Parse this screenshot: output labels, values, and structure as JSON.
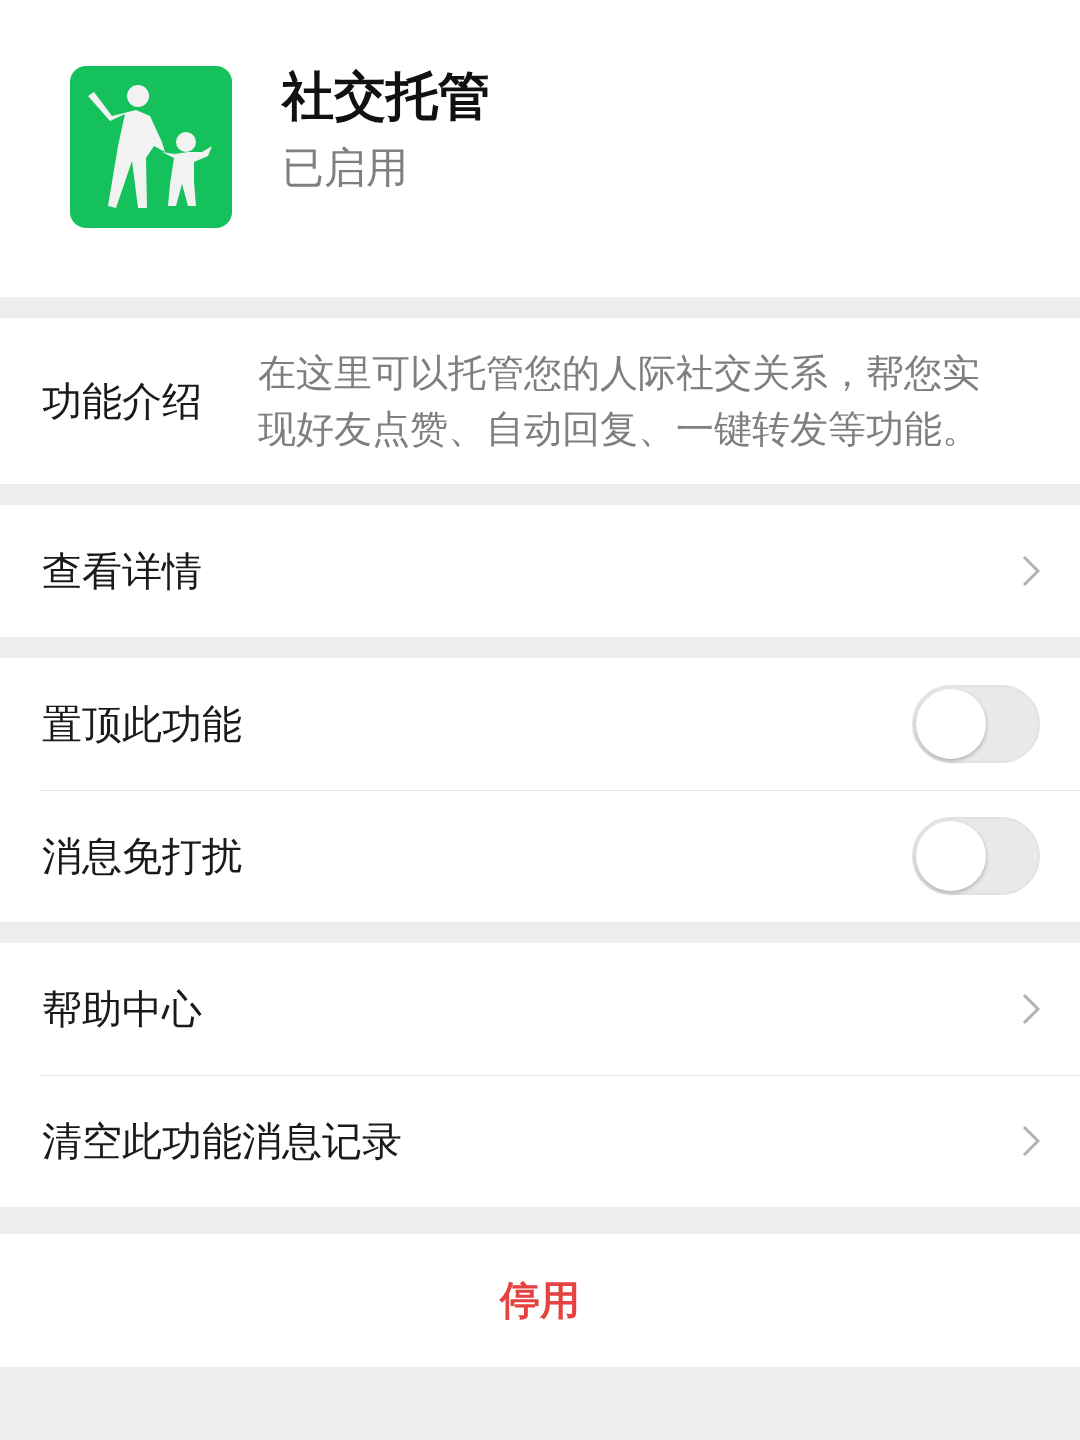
{
  "app": {
    "name": "社交托管",
    "status": "已启用"
  },
  "intro": {
    "label": "功能介绍",
    "text": "在这里可以托管您的人际社交关系，帮您实现好友点赞、自动回复、一键转发等功能。"
  },
  "sections": [
    [
      {
        "kind": "link",
        "label": "查看详情"
      }
    ],
    [
      {
        "kind": "toggle",
        "label": "置顶此功能",
        "on": false
      },
      {
        "kind": "toggle",
        "label": "消息免打扰",
        "on": false
      }
    ],
    [
      {
        "kind": "link",
        "label": "帮助中心"
      },
      {
        "kind": "link",
        "label": "清空此功能消息记录"
      }
    ]
  ],
  "action": {
    "label": "停用"
  }
}
